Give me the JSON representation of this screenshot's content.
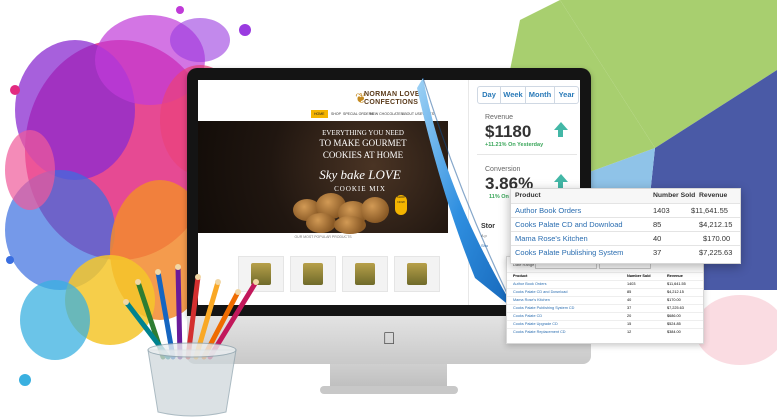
{
  "site": {
    "brand_line1": "NORMAN LOVE",
    "brand_line2": "CONFECTIONS",
    "nav": [
      "HOME",
      "SHOP",
      "SPECIAL ORDERS",
      "NEW CHOCOLATES",
      "ABOUT US",
      "EVENTS",
      "CLASSES"
    ],
    "hero_line1": "EVERYTHING YOU NEED",
    "hero_line2": "TO MAKE GOURMET",
    "hero_line3": "COOKIES AT HOME",
    "hero_brand_script": "Sky bake LOVE",
    "hero_product": "COOKIE MIX",
    "shop_button": "SHOP NOW",
    "products_title": "OUR MOST POPULAR PRODUCTS"
  },
  "stats": {
    "tabs": [
      "Day",
      "Week",
      "Month",
      "Year"
    ],
    "active_tab": "Day",
    "revenue_label": "Revenue",
    "revenue_value": "$1180",
    "revenue_change": "+11.21% On Yesterday",
    "conversion_label": "Conversion",
    "conversion_value": "3.86%",
    "conversion_change": "11% On Yesterday",
    "store_label": "Stor",
    "store_sub": "A p",
    "show_label": "Sho",
    "your_label": "Your"
  },
  "popup": {
    "headers": [
      "Product",
      "Number Sold",
      "Revenue"
    ],
    "rows": [
      [
        "Author Book Orders",
        "1403",
        "$11,641.55"
      ],
      [
        "Cooks Palate CD and Download",
        "85",
        "$4,212.15"
      ],
      [
        "Mama Rose's Kitchen",
        "40",
        "$170.00"
      ],
      [
        "Cooks Palate Publishing System",
        "37",
        "$7,225.63"
      ]
    ]
  },
  "report": {
    "date_range_label": "Date Range",
    "headers": [
      "Product",
      "Number Sold",
      "Revenue"
    ],
    "rows": [
      [
        "Author Book Orders",
        "1403",
        "$11,641.55"
      ],
      [
        "Cooks Palate CD and Download",
        "85",
        "$4,212.15"
      ],
      [
        "Mama Rose's Kitchen",
        "40",
        "$170.00"
      ],
      [
        "Cooks Palate Publishing System CD",
        "37",
        "$7,225.63"
      ],
      [
        "Cooks Palate CD",
        "20",
        "$686.00"
      ],
      [
        "Cooks Palate Upgrade CD",
        "15",
        "$524.85"
      ],
      [
        "Cooks Palate Replacement CD",
        "12",
        "$384.00"
      ]
    ]
  },
  "colors": {
    "accent_blue": "#2a6db0",
    "nav_highlight": "#f4b400",
    "positive_green": "#3aa65a",
    "arrow_teal": "#43b7a6",
    "pie_green": "#a8cf6f",
    "pie_navy": "#4a5aa6",
    "pie_lightblue": "#8fc3e8"
  },
  "icons": [
    "apple-logo-icon",
    "up-arrow-icon"
  ]
}
